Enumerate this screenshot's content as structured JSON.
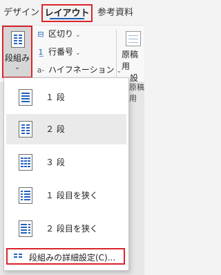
{
  "tabs": {
    "design": "デザイン",
    "layout": "レイアウト",
    "references": "参考資料"
  },
  "ribbon": {
    "columns_button": {
      "label": "段組み",
      "dropdown_glyph": "⌄",
      "icon": "columns-icon"
    },
    "breaks": {
      "label": "区切り",
      "icon": "breaks-icon"
    },
    "line_numbers": {
      "label": "行番号",
      "icon": "line-numbers-icon"
    },
    "hyphenation": {
      "label": "ハイフネーション",
      "icon": "hyphenation-icon"
    },
    "genko": {
      "line1": "原稿用",
      "line2": "設",
      "icon": "manuscript-icon"
    }
  },
  "document": {
    "right_text": "原稿用"
  },
  "menu": {
    "items": [
      {
        "label": "１ 段",
        "icon": "one-column-icon"
      },
      {
        "label": "２ 段",
        "icon": "two-columns-icon",
        "selected": true
      },
      {
        "label": "３ 段",
        "icon": "three-columns-icon"
      },
      {
        "label": "１ 段目を狭く",
        "icon": "left-narrow-columns-icon"
      },
      {
        "label": "２ 段目を狭く",
        "icon": "right-narrow-columns-icon"
      }
    ],
    "more": {
      "label": "段組みの詳細設定(C)...",
      "icon": "columns-settings-icon"
    }
  },
  "colors": {
    "highlight_border": "#d9232b",
    "accent_blue": "#1f5fbf",
    "selected_item_bg": "#eaeaea"
  }
}
